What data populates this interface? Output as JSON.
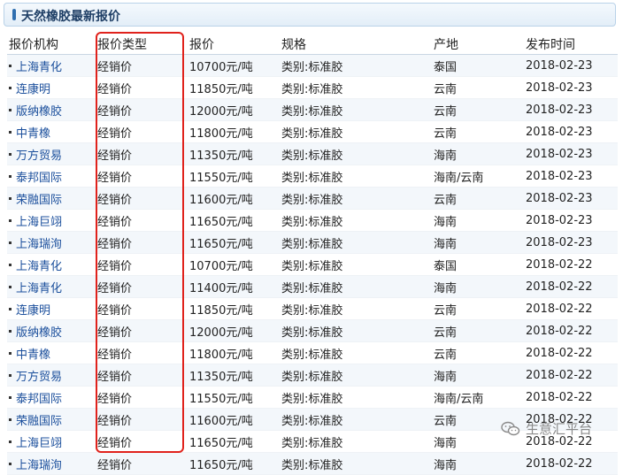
{
  "panel": {
    "title": "天然橡胶最新报价"
  },
  "table": {
    "headers": [
      "报价机构",
      "报价类型",
      "报价",
      "规格",
      "产地",
      "发布时间"
    ],
    "rows": [
      {
        "org": "上海青化",
        "type": "经销价",
        "price": "10700元/吨",
        "spec": "类别:标准胶",
        "origin": "泰国",
        "date": "2018-02-23"
      },
      {
        "org": "连康明",
        "type": "经销价",
        "price": "11850元/吨",
        "spec": "类别:标准胶",
        "origin": "云南",
        "date": "2018-02-23"
      },
      {
        "org": "版纳橡胶",
        "type": "经销价",
        "price": "12000元/吨",
        "spec": "类别:标准胶",
        "origin": "云南",
        "date": "2018-02-23"
      },
      {
        "org": "中青橡",
        "type": "经销价",
        "price": "11800元/吨",
        "spec": "类别:标准胶",
        "origin": "云南",
        "date": "2018-02-23"
      },
      {
        "org": "万方贸易",
        "type": "经销价",
        "price": "11350元/吨",
        "spec": "类别:标准胶",
        "origin": "海南",
        "date": "2018-02-23"
      },
      {
        "org": "泰邦国际",
        "type": "经销价",
        "price": "11550元/吨",
        "spec": "类别:标准胶",
        "origin": "海南/云南",
        "date": "2018-02-23"
      },
      {
        "org": "荣融国际",
        "type": "经销价",
        "price": "11600元/吨",
        "spec": "类别:标准胶",
        "origin": "云南",
        "date": "2018-02-23"
      },
      {
        "org": "上海巨翊",
        "type": "经销价",
        "price": "11650元/吨",
        "spec": "类别:标准胶",
        "origin": "海南",
        "date": "2018-02-23"
      },
      {
        "org": "上海瑞洵",
        "type": "经销价",
        "price": "11650元/吨",
        "spec": "类别:标准胶",
        "origin": "海南",
        "date": "2018-02-23"
      },
      {
        "org": "上海青化",
        "type": "经销价",
        "price": "10700元/吨",
        "spec": "类别:标准胶",
        "origin": "泰国",
        "date": "2018-02-22"
      },
      {
        "org": "上海青化",
        "type": "经销价",
        "price": "11400元/吨",
        "spec": "类别:标准胶",
        "origin": "海南",
        "date": "2018-02-22"
      },
      {
        "org": "连康明",
        "type": "经销价",
        "price": "11850元/吨",
        "spec": "类别:标准胶",
        "origin": "云南",
        "date": "2018-02-22"
      },
      {
        "org": "版纳橡胶",
        "type": "经销价",
        "price": "12000元/吨",
        "spec": "类别:标准胶",
        "origin": "云南",
        "date": "2018-02-22"
      },
      {
        "org": "中青橡",
        "type": "经销价",
        "price": "11800元/吨",
        "spec": "类别:标准胶",
        "origin": "云南",
        "date": "2018-02-22"
      },
      {
        "org": "万方贸易",
        "type": "经销价",
        "price": "11350元/吨",
        "spec": "类别:标准胶",
        "origin": "海南",
        "date": "2018-02-22"
      },
      {
        "org": "泰邦国际",
        "type": "经销价",
        "price": "11550元/吨",
        "spec": "类别:标准胶",
        "origin": "海南/云南",
        "date": "2018-02-22"
      },
      {
        "org": "荣融国际",
        "type": "经销价",
        "price": "11600元/吨",
        "spec": "类别:标准胶",
        "origin": "云南",
        "date": "2018-02-22"
      },
      {
        "org": "上海巨翊",
        "type": "经销价",
        "price": "11650元/吨",
        "spec": "类别:标准胶",
        "origin": "海南",
        "date": "2018-02-22"
      },
      {
        "org": "上海瑞洵",
        "type": "经销价",
        "price": "11650元/吨",
        "spec": "类别:标准胶",
        "origin": "海南",
        "date": "2018-02-22"
      }
    ]
  },
  "watermark": {
    "text": "生意汇平台",
    "icon": "wechat-icon"
  },
  "colors": {
    "link": "#1b4f9c",
    "highlight_border": "#e0221c",
    "title": "#1f3f66"
  }
}
